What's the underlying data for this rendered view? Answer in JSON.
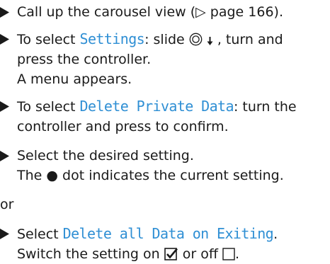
{
  "steps": [
    {
      "line1": "Call up the carousel view (▷ page 166)."
    },
    {
      "pre": "To select ",
      "menu": "Settings",
      "post_a": ": slide ",
      "post_b": " , turn and",
      "line2": "press the controller.",
      "line3": "A menu appears."
    },
    {
      "pre": "To select ",
      "menu": "Delete Private Data",
      "post": ": turn the",
      "line2": "controller and press to confirm."
    },
    {
      "line1": "Select the desired setting.",
      "line2_pre": "The ",
      "line2_dot": "●",
      "line2_post": " dot indicates the current setting."
    }
  ],
  "or_label": "or",
  "last_step": {
    "pre": "Select ",
    "menu": "Delete all Data on Exiting",
    "post": ".",
    "line2_pre": "Switch the setting on ",
    "line2_mid": " or off ",
    "line2_post": "."
  },
  "icons": {
    "bullet": "bullet-arrow-icon",
    "controller": "controller-icon",
    "down": "down-arrow-icon",
    "checked": "checkbox-checked-icon",
    "unchecked": "checkbox-unchecked-icon"
  },
  "colors": {
    "text": "#1a1a1a",
    "menu_text": "#2f8fd4"
  }
}
